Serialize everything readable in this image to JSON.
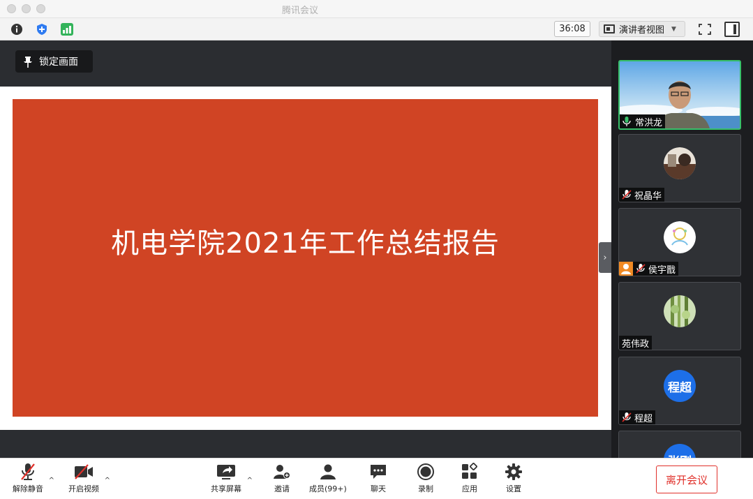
{
  "window": {
    "title": "腾讯会议"
  },
  "toolbar": {
    "timer": "36:08",
    "view_label": "演讲者视图"
  },
  "stage": {
    "lock_label": "锁定画面",
    "slide_title": "机电学院2021年工作总结报告",
    "slide_color": "#d04424"
  },
  "participants": [
    {
      "name": "常洪龙",
      "mic": "on",
      "active": true
    },
    {
      "name": "祝晶华",
      "mic": "muted"
    },
    {
      "name": "侯宇戬",
      "mic": "muted",
      "host": true
    },
    {
      "name": "苑伟政",
      "mic": "none"
    },
    {
      "name": "程超",
      "mic": "muted",
      "avatar_text": "程超"
    },
    {
      "name": "",
      "avatar_text": "张刚"
    }
  ],
  "bottom": {
    "unmute": "解除静音",
    "video": "开启视频",
    "share": "共享屏幕",
    "invite": "邀请",
    "members": "成员(99+)",
    "chat": "聊天",
    "record": "录制",
    "apps": "应用",
    "settings": "设置",
    "leave": "离开会议"
  },
  "colors": {
    "accent_green": "#37c06a",
    "leave_red": "#e0302a",
    "avatar_blue": "#1d6fe8"
  }
}
